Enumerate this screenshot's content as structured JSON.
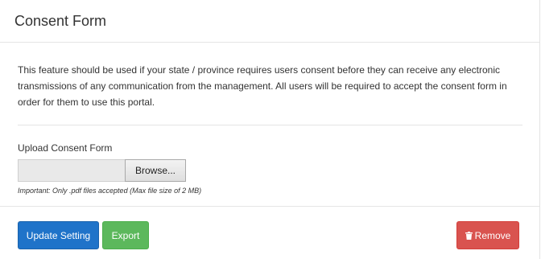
{
  "header": {
    "title": "Consent Form"
  },
  "body": {
    "intro": "This feature should be used if your state / province requires users consent before they can receive any electronic transmissions of any communication from the management. All users will be required to accept the consent form in order for them to use this portal.",
    "upload_label": "Upload Consent Form",
    "browse_label": "Browse...",
    "hint": "Important: Only .pdf files accepted (Max file size of 2 MB)"
  },
  "footer": {
    "update_label": "Update Setting",
    "export_label": "Export",
    "remove_label": "Remove",
    "remove_icon": "trash-icon"
  },
  "colors": {
    "primary": "#1f73c9",
    "success": "#5cb85c",
    "danger": "#d9534f"
  }
}
